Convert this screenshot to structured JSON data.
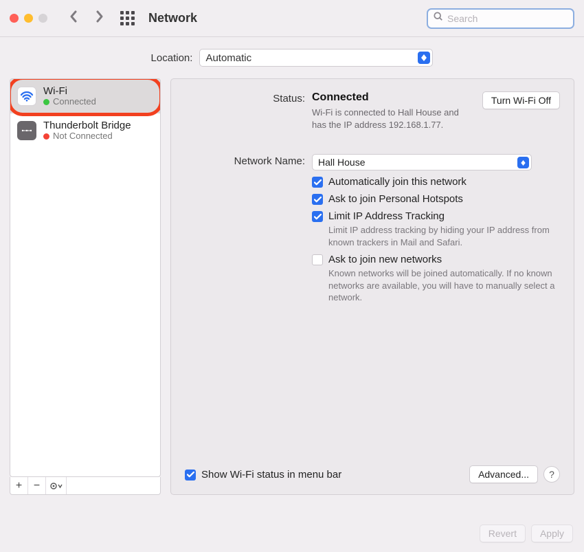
{
  "toolbar": {
    "title": "Network",
    "search_placeholder": "Search"
  },
  "location": {
    "label": "Location:",
    "value": "Automatic"
  },
  "sidebar": {
    "items": [
      {
        "name": "Wi-Fi",
        "status": "Connected",
        "dot": "green",
        "selected": true,
        "icon": "wifi"
      },
      {
        "name": "Thunderbolt Bridge",
        "status": "Not Connected",
        "dot": "red",
        "selected": false,
        "icon": "bridge"
      }
    ],
    "footer": {
      "add": "+",
      "remove": "−",
      "more": "⊙"
    }
  },
  "panel": {
    "status_label": "Status:",
    "status_value": "Connected",
    "wifi_button": "Turn Wi-Fi Off",
    "status_note": "Wi-Fi is connected to Hall House and has the IP address 192.168.1.77.",
    "network_name_label": "Network Name:",
    "network_name_value": "Hall House",
    "checkboxes": [
      {
        "label": "Automatically join this network",
        "checked": true,
        "sub": ""
      },
      {
        "label": "Ask to join Personal Hotspots",
        "checked": true,
        "sub": ""
      },
      {
        "label": "Limit IP Address Tracking",
        "checked": true,
        "sub": "Limit IP address tracking by hiding your IP address from known trackers in Mail and Safari."
      },
      {
        "label": "Ask to join new networks",
        "checked": false,
        "sub": "Known networks will be joined automatically. If no known networks are available, you will have to manually select a network."
      }
    ],
    "show_in_menubar": {
      "label": "Show Wi-Fi status in menu bar",
      "checked": true
    },
    "advanced": "Advanced...",
    "help": "?"
  },
  "footer": {
    "revert": "Revert",
    "apply": "Apply"
  }
}
